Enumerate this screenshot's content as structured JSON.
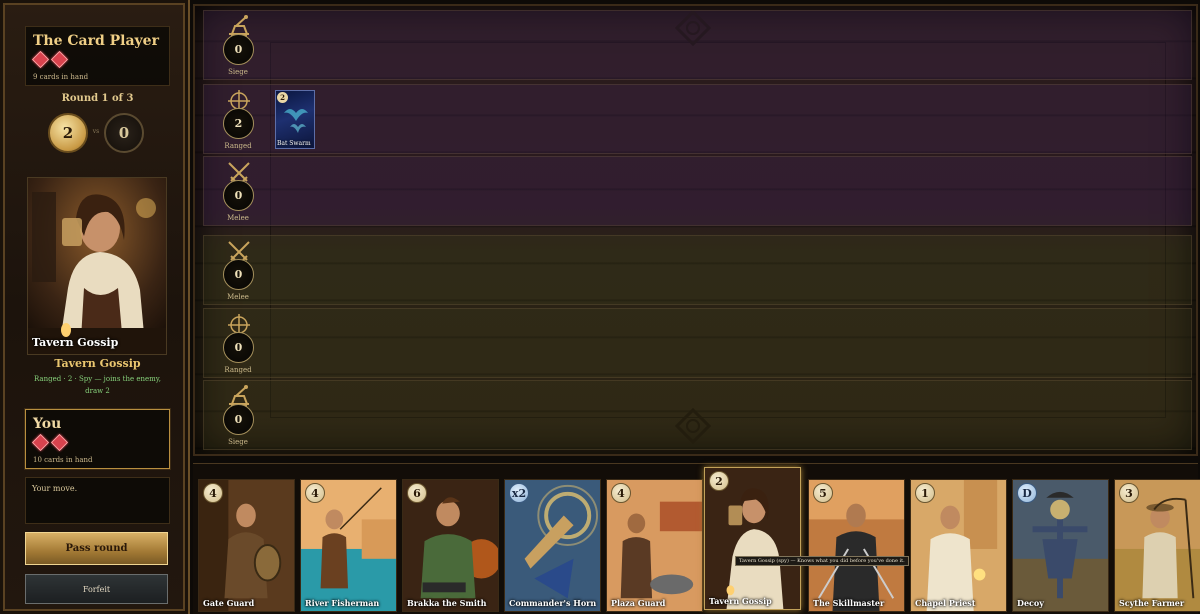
{
  "opponent": {
    "name": "The Card Player",
    "hand_count": "9 cards in hand",
    "gems": 2
  },
  "round": {
    "label": "Round 1 of 3",
    "score_you": "2",
    "vs": "vs",
    "score_opponent": "0"
  },
  "preview": {
    "card_name": "Tavern Gossip",
    "title": "Tavern Gossip",
    "description": "Ranged · 2 · Spy — joins the enemy, draw 2"
  },
  "you": {
    "name": "You",
    "hand_count": "10 cards in hand",
    "gems": 2
  },
  "log": "Your move.",
  "buttons": {
    "pass": "Pass round",
    "forfeit": "Forfeit"
  },
  "board": {
    "rows": [
      {
        "side": "opponent",
        "type": "Siege",
        "score": "0",
        "icon": "catapult-icon"
      },
      {
        "side": "opponent",
        "type": "Ranged",
        "score": "2",
        "icon": "crosshair-icon"
      },
      {
        "side": "opponent",
        "type": "Melee",
        "score": "0",
        "icon": "crossed-swords-icon"
      },
      {
        "side": "you",
        "type": "Melee",
        "score": "0",
        "icon": "crossed-swords-icon"
      },
      {
        "side": "you",
        "type": "Ranged",
        "score": "0",
        "icon": "crosshair-icon"
      },
      {
        "side": "you",
        "type": "Siege",
        "score": "0",
        "icon": "catapult-icon"
      }
    ],
    "opponent_ranged_cards": [
      {
        "name": "Bat Swarm",
        "power": "2"
      }
    ]
  },
  "hand": [
    {
      "name": "Gate Guard",
      "power": "4",
      "special": false
    },
    {
      "name": "River Fisherman",
      "power": "4",
      "special": false
    },
    {
      "name": "Brakka the Smith",
      "power": "6",
      "special": false
    },
    {
      "name": "Commander's Horn",
      "power": "x2",
      "special": true
    },
    {
      "name": "Plaza Guard",
      "power": "4",
      "special": false
    },
    {
      "name": "Tavern Gossip",
      "power": "2",
      "special": false
    },
    {
      "name": "The Skillmaster",
      "power": "5",
      "special": false
    },
    {
      "name": "Chapel Priest",
      "power": "1",
      "special": false
    },
    {
      "name": "Decoy",
      "power": "D",
      "special": true
    },
    {
      "name": "Scythe Farmer",
      "power": "3",
      "special": false
    }
  ],
  "tooltip": "Tavern Gossip (spy) — Knows what you did before you've done it."
}
